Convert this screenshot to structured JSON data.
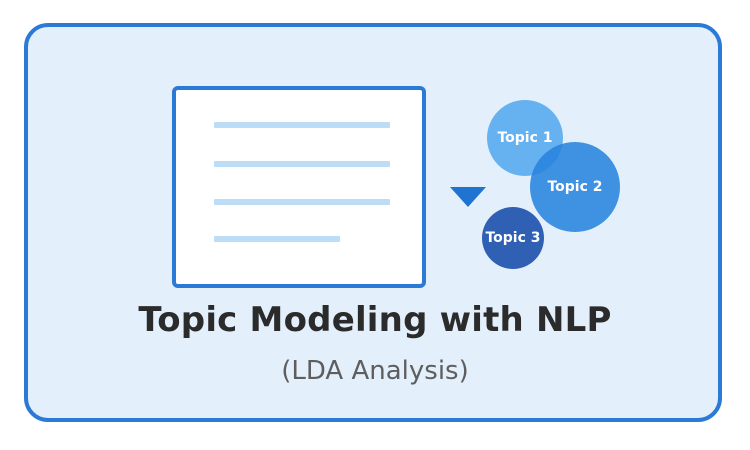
{
  "diagram": {
    "title": "Topic Modeling with NLP",
    "subtitle": "(LDA Analysis)",
    "topics": [
      {
        "label": "Topic 1"
      },
      {
        "label": "Topic 2"
      },
      {
        "label": "Topic 3"
      }
    ],
    "document_icon": "document-icon",
    "arrow_icon": "arrow-down-icon",
    "colors": {
      "accent": "#2a7ad6",
      "background": "#e3f0fc",
      "topic_1": "#63b0f0",
      "topic_2": "#2883de",
      "topic_3": "#2a5bb2",
      "doc_lines": "#bddcf6",
      "title_text": "#2b2b2b",
      "subtitle_text": "#5e5e5e"
    }
  }
}
